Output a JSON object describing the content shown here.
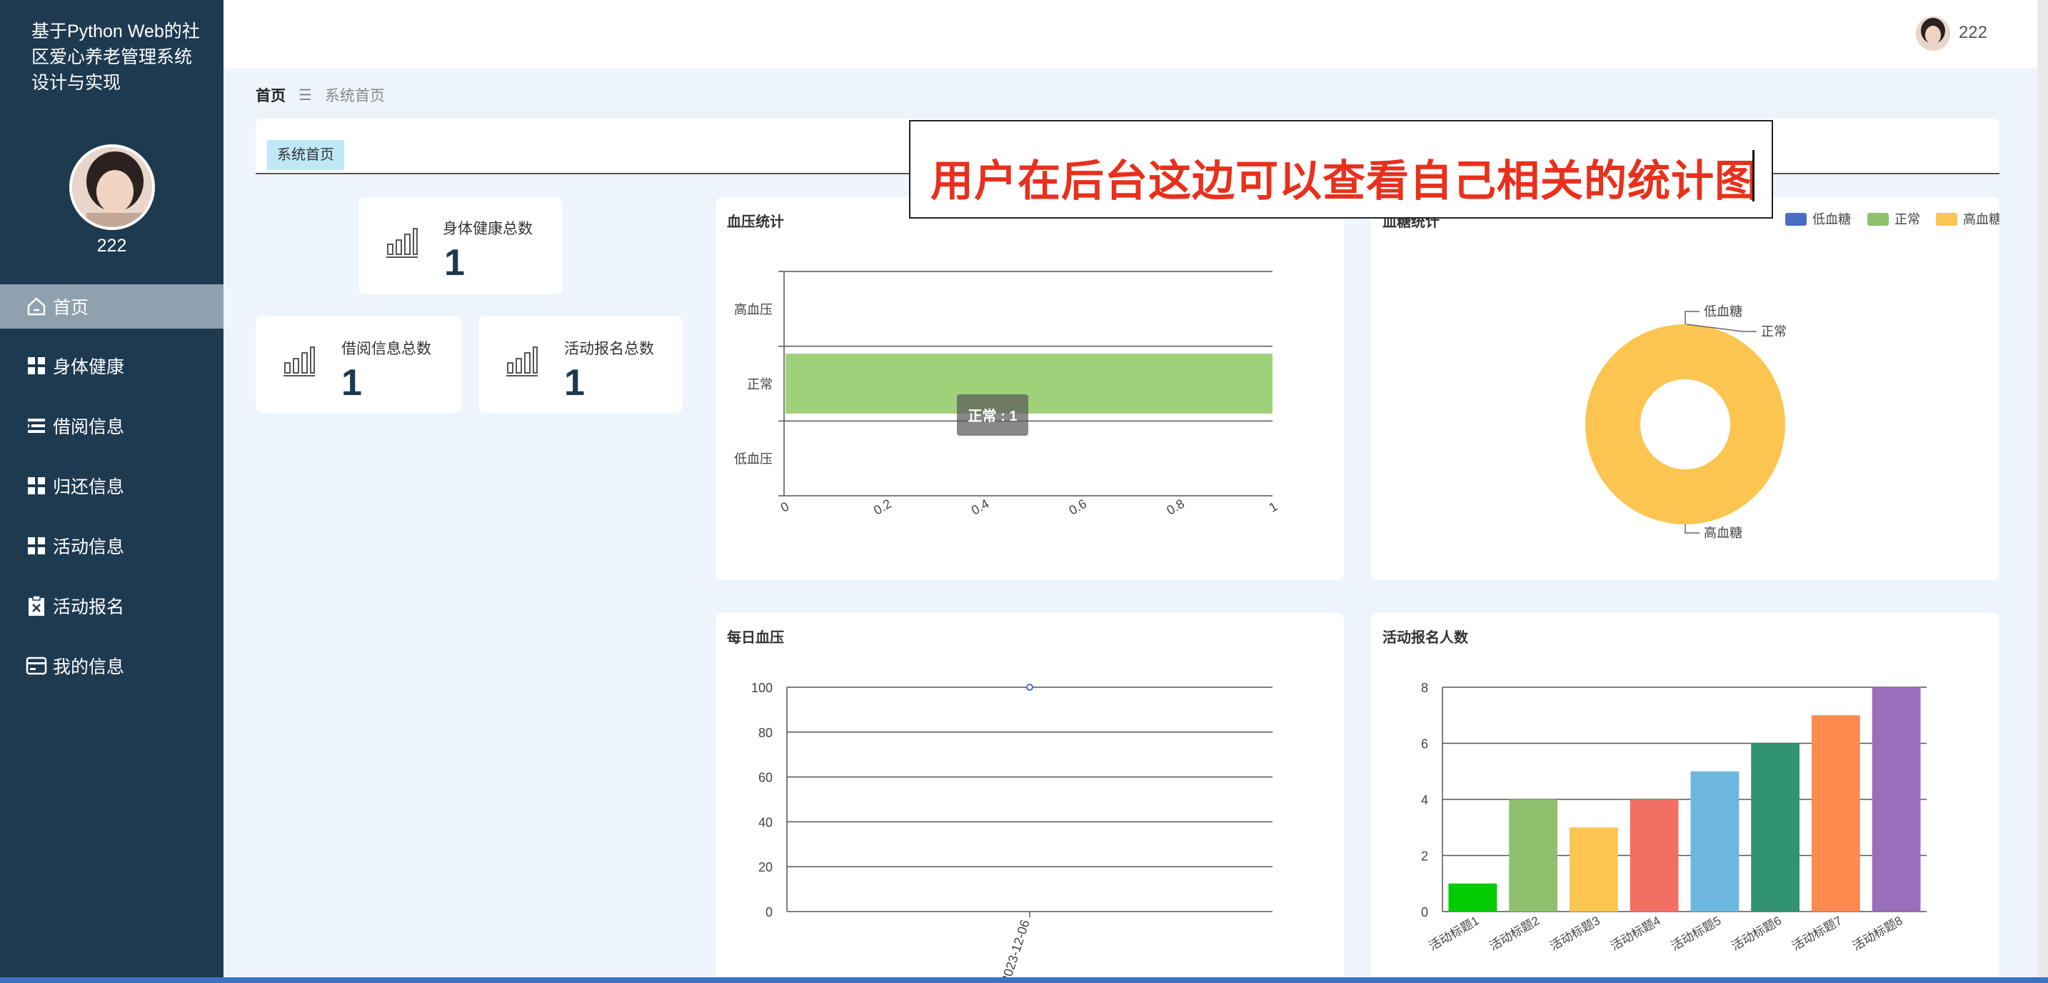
{
  "app": {
    "title": "基于Python Web的社区爱心养老管理系统设计与实现",
    "user": "222"
  },
  "sidebar": {
    "items": [
      {
        "label": "首页",
        "icon": "home-icon",
        "active": true
      },
      {
        "label": "身体健康",
        "icon": "grid-icon"
      },
      {
        "label": "借阅信息",
        "icon": "list-icon"
      },
      {
        "label": "归还信息",
        "icon": "grid-icon"
      },
      {
        "label": "活动信息",
        "icon": "grid-icon"
      },
      {
        "label": "活动报名",
        "icon": "clipboard-icon"
      },
      {
        "label": "我的信息",
        "icon": "card-icon"
      }
    ]
  },
  "breadcrumb": {
    "home": "首页",
    "sep": "☰",
    "current": "系统首页"
  },
  "tabs": [
    {
      "label": "系统首页"
    }
  ],
  "stats": [
    {
      "label": "身体健康总数",
      "value": "1"
    },
    {
      "label": "借阅信息总数",
      "value": "1"
    },
    {
      "label": "活动报名总数",
      "value": "1"
    }
  ],
  "annotation": {
    "text": "用户在后台这边可以查看自己相关的统计图"
  },
  "colors": {
    "sidebar": "#1e3a50",
    "accent": "#3b74c4",
    "annotation": "#e8301c"
  },
  "chart_data": [
    {
      "type": "bar",
      "orientation": "horizontal",
      "title": "血压统计",
      "categories": [
        "低血压",
        "正常",
        "高血压"
      ],
      "values": [
        0,
        1,
        0
      ],
      "xlim": [
        0,
        1
      ],
      "x_ticks": [
        "0",
        "0.2",
        "0.4",
        "0.6",
        "0.8",
        "1"
      ],
      "tooltip": "正常 : 1",
      "color": "#9ed17a"
    },
    {
      "type": "pie",
      "title": "血糖统计",
      "legend": [
        "低血糖",
        "正常",
        "高血糖"
      ],
      "legend_colors": [
        "#4a6cc4",
        "#8fc06e",
        "#fcc550"
      ],
      "values": [
        0,
        0,
        1
      ],
      "legend_position": "top-right"
    },
    {
      "type": "line",
      "title": "每日血压",
      "x": [
        "2023-12-06"
      ],
      "values": [
        100
      ],
      "ylim": [
        0,
        100
      ],
      "y_ticks": [
        "0",
        "20",
        "40",
        "60",
        "80",
        "100"
      ]
    },
    {
      "type": "bar",
      "title": "活动报名人数",
      "categories": [
        "活动标题1",
        "活动标题2",
        "活动标题3",
        "活动标题4",
        "活动标题5",
        "活动标题6",
        "活动标题7",
        "活动标题8"
      ],
      "values": [
        1,
        4,
        3,
        4,
        5,
        6,
        7,
        8
      ],
      "colors": [
        "#00cc00",
        "#8fc06e",
        "#fcc550",
        "#f26f63",
        "#6cb7de",
        "#31936f",
        "#ff8a4f",
        "#9b6dbb"
      ],
      "ylim": [
        0,
        8
      ],
      "y_ticks": [
        "0",
        "2",
        "4",
        "6",
        "8"
      ]
    }
  ]
}
